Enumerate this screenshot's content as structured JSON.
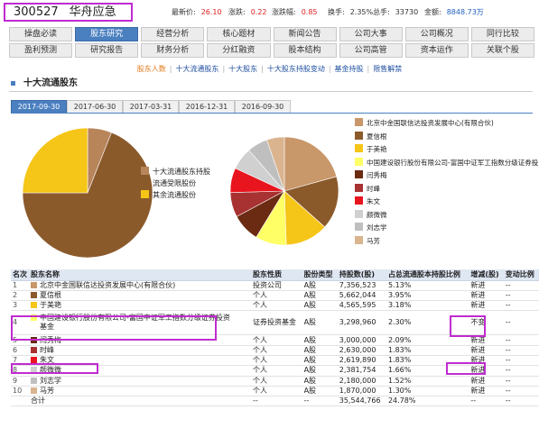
{
  "quote": {
    "code": "300527",
    "name": "华舟应急",
    "items": [
      {
        "label": "最新价:",
        "value": "26.10",
        "cls": "red"
      },
      {
        "label": "涨跌:",
        "value": "0.22",
        "cls": "red"
      },
      {
        "label": "涨跌幅:",
        "value": "0.85",
        "cls": "red"
      },
      {
        "label": "换手:",
        "value": "2.35%",
        "cls": ""
      },
      {
        "label": "总手:",
        "value": "33730",
        "cls": ""
      },
      {
        "label": "金额:",
        "value": "8848.73万",
        "cls": "blue"
      }
    ]
  },
  "nav": {
    "row1": [
      "操盘必读",
      "股东研究",
      "经营分析",
      "核心题材",
      "新闻公告",
      "公司大事",
      "公司概况",
      "同行比较"
    ],
    "row2": [
      "盈利预测",
      "研究报告",
      "财务分析",
      "分红融资",
      "股本结构",
      "公司高管",
      "资本运作",
      "关联个股"
    ],
    "active": "股东研究"
  },
  "subnav": [
    "股东人数",
    "十大流通股东",
    "十大股东",
    "十大股东持股变动",
    "基金持股",
    "限售解禁"
  ],
  "subnav_current": "股东人数",
  "section_title": "十大流通股东",
  "tabs": [
    "2017-09-30",
    "2017-06-30",
    "2017-03-31",
    "2016-12-31",
    "2016-09-30"
  ],
  "legend1": [
    {
      "label": "十大流通股东持股",
      "color": "#b8845a"
    },
    {
      "label": "流通受限股份",
      "color": "#8b5a2b"
    },
    {
      "label": "其余流通股份",
      "color": "#f5c518"
    }
  ],
  "legend2": [
    {
      "label": "北京中金国联信达投资发展中心(有限合伙)",
      "color": "#c8976a"
    },
    {
      "label": "夏信根",
      "color": "#8b5a2b"
    },
    {
      "label": "于美艳",
      "color": "#f5c518"
    },
    {
      "label": "中国建设银行股份有限公司-富国中证军工指数分级证券投",
      "color": "#ffff66"
    },
    {
      "label": "闫秀梅",
      "color": "#6b2a12"
    },
    {
      "label": "时峰",
      "color": "#a83232"
    },
    {
      "label": "朱文",
      "color": "#e8141e"
    },
    {
      "label": "颜微微",
      "color": "#d0d0d0"
    },
    {
      "label": "刘志学",
      "color": "#bfbfbf"
    },
    {
      "label": "马芳",
      "color": "#d9b48f"
    }
  ],
  "chart_data": [
    {
      "type": "pie",
      "categories": [
        "十大流通股东持股",
        "流通受限股份",
        "其余流通股份"
      ],
      "values": [
        6,
        69,
        25
      ]
    },
    {
      "type": "pie",
      "categories": [
        "北京中金国联信达投资发展中心(有限合伙)",
        "夏信根",
        "于美艳",
        "中国建设银行股份有限公司-富国中证军工指数分级证券投",
        "闫秀梅",
        "时峰",
        "朱文",
        "颜微微",
        "刘志学",
        "马芳"
      ],
      "values": [
        7356523,
        5662044,
        4565595,
        3298960,
        3000000,
        2630000,
        2619890,
        2381754,
        2180000,
        1870000
      ]
    }
  ],
  "table": {
    "headers": [
      "名次",
      "股东名称",
      "股东性质",
      "股份类型",
      "持股数(股)",
      "占总流通股本持股比例",
      "增减(股)",
      "变动比例"
    ],
    "rows": [
      {
        "rank": "1",
        "name": "北京中金国联信达投资发展中心(有限合伙)",
        "nature": "投资公司",
        "type": "A股",
        "shares": "7,356,523",
        "ratio": "5.13%",
        "change": "新进",
        "pct": "--"
      },
      {
        "rank": "2",
        "name": "夏信根",
        "nature": "个人",
        "type": "A股",
        "shares": "5,662,044",
        "ratio": "3.95%",
        "change": "新进",
        "pct": "--"
      },
      {
        "rank": "3",
        "name": "于美艳",
        "nature": "个人",
        "type": "A股",
        "shares": "4,565,595",
        "ratio": "3.18%",
        "change": "新进",
        "pct": "--"
      },
      {
        "rank": "4",
        "name": "中国建设银行股份有限公司-富国中证军工指数分级证券投资基金",
        "nature": "证券投资基金",
        "type": "A股",
        "shares": "3,298,960",
        "ratio": "2.30%",
        "change": "不变",
        "pct": "--"
      },
      {
        "rank": "5",
        "name": "闫秀梅",
        "nature": "个人",
        "type": "A股",
        "shares": "3,000,000",
        "ratio": "2.09%",
        "change": "新进",
        "pct": "--"
      },
      {
        "rank": "6",
        "name": "时峰",
        "nature": "个人",
        "type": "A股",
        "shares": "2,630,000",
        "ratio": "1.83%",
        "change": "新进",
        "pct": "--"
      },
      {
        "rank": "7",
        "name": "朱文",
        "nature": "个人",
        "type": "A股",
        "shares": "2,619,890",
        "ratio": "1.83%",
        "change": "新进",
        "pct": "--"
      },
      {
        "rank": "8",
        "name": "颜微微",
        "nature": "个人",
        "type": "A股",
        "shares": "2,381,754",
        "ratio": "1.66%",
        "change": "新进",
        "pct": "--"
      },
      {
        "rank": "9",
        "name": "刘志学",
        "nature": "个人",
        "type": "A股",
        "shares": "2,180,000",
        "ratio": "1.52%",
        "change": "新进",
        "pct": "--"
      },
      {
        "rank": "10",
        "name": "马芳",
        "nature": "个人",
        "type": "A股",
        "shares": "1,870,000",
        "ratio": "1.30%",
        "change": "新进",
        "pct": "--"
      }
    ],
    "total": {
      "label": "合计",
      "nature": "--",
      "type": "--",
      "shares": "35,544,766",
      "ratio": "24.78%",
      "change": "--",
      "pct": "--"
    }
  }
}
